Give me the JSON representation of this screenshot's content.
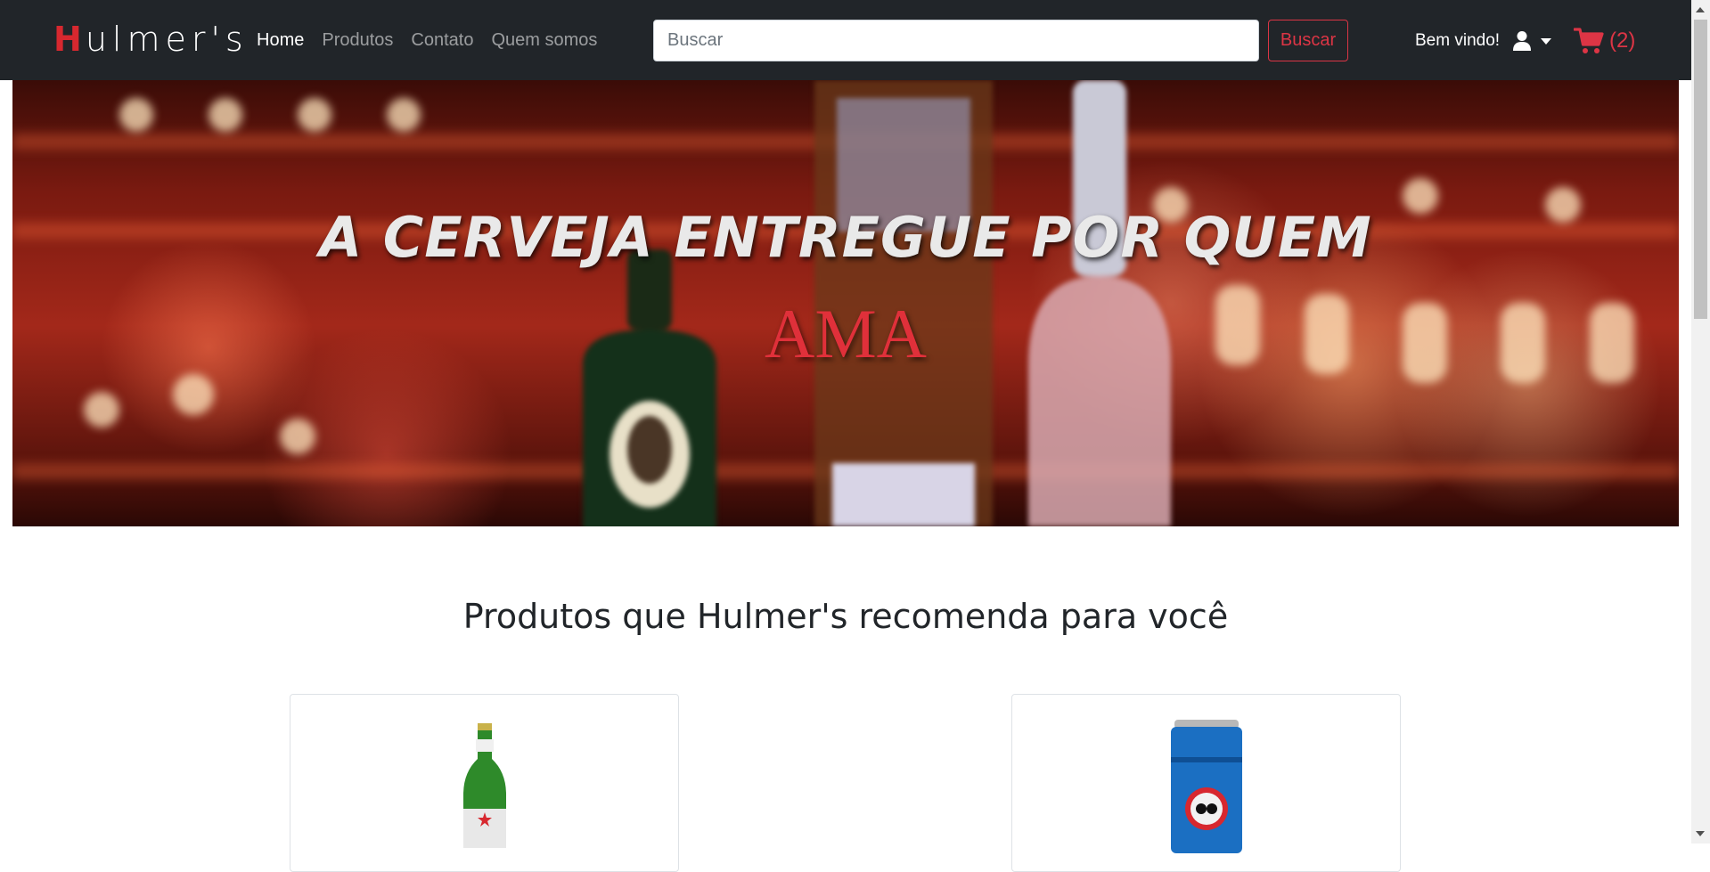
{
  "brand": {
    "first_letter": "H",
    "rest": "ulmer's"
  },
  "nav": {
    "links": [
      {
        "label": "Home",
        "active": true
      },
      {
        "label": "Produtos",
        "active": false
      },
      {
        "label": "Contato",
        "active": false
      },
      {
        "label": "Quem somos",
        "active": false
      }
    ]
  },
  "search": {
    "placeholder": "Buscar",
    "value": "",
    "button_label": "Buscar"
  },
  "user": {
    "welcome": "Bem vindo!",
    "icon": "user-icon",
    "dropdown_icon": "caret-down-icon"
  },
  "cart": {
    "icon": "shopping-cart-icon",
    "count_label": "(2)"
  },
  "hero": {
    "title": "A CERVEJA ENTREGUE POR QUEM",
    "accent": "AMA"
  },
  "section": {
    "title": "Produtos que Hulmer's recomenda para você"
  },
  "products": [
    {
      "image": "green-beer-bottle-image"
    },
    {
      "image": "blue-beer-can-image"
    }
  ],
  "colors": {
    "navbar_bg": "#212529",
    "accent_red": "#dc3545",
    "brand_red": "#d7282f"
  }
}
